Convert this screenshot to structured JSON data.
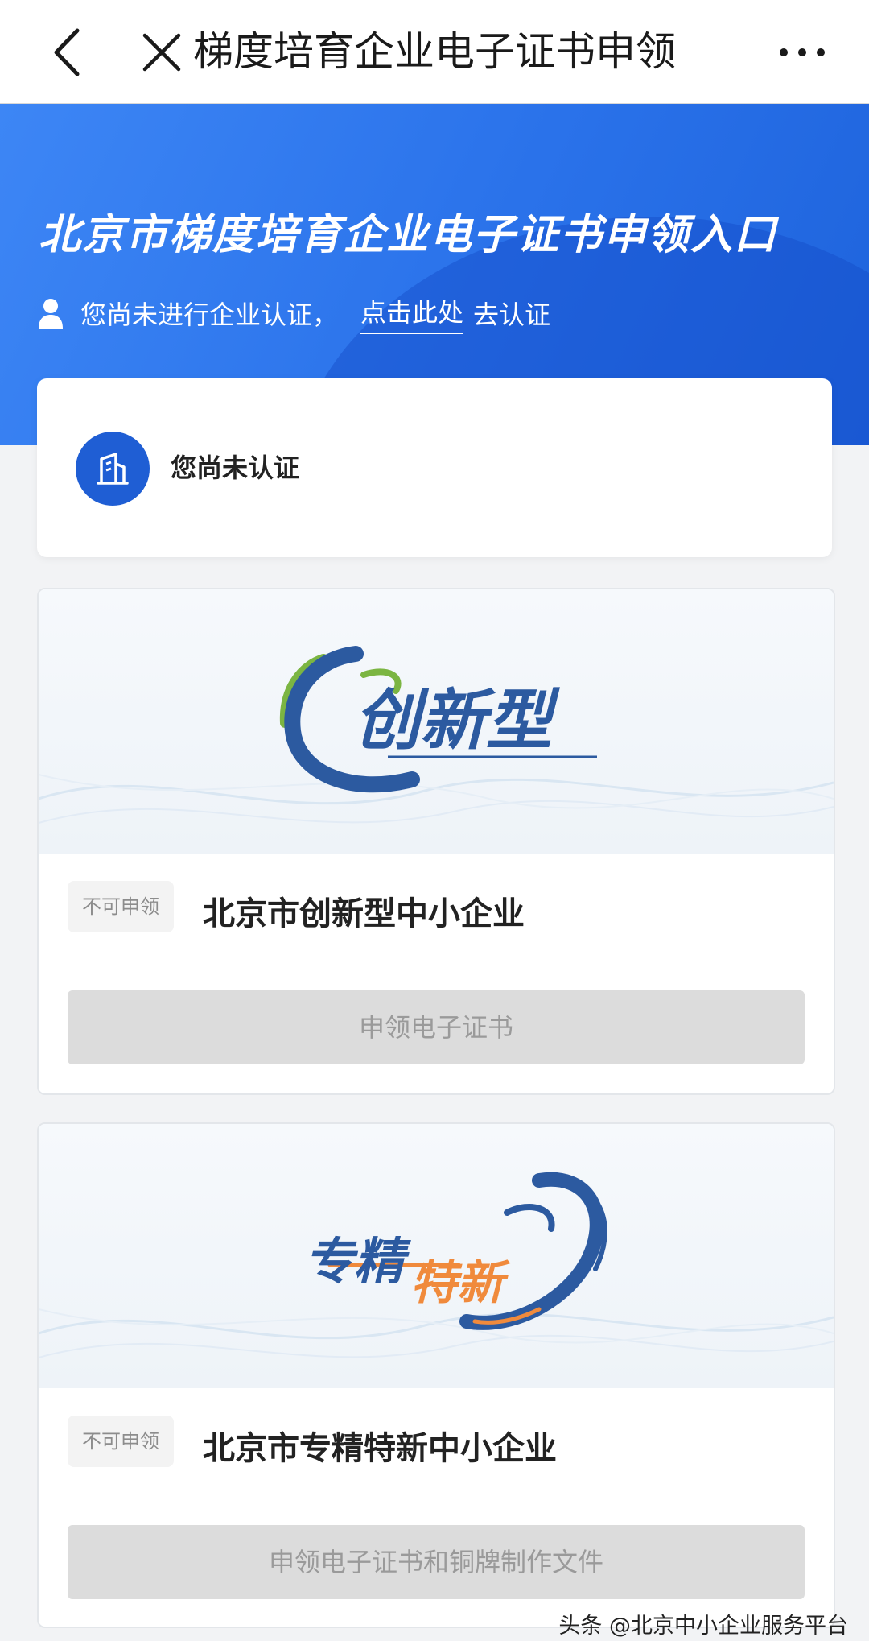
{
  "nav": {
    "title": "梯度培育企业电子证书申领"
  },
  "banner": {
    "title": "北京市梯度培育企业电子证书申领入口",
    "notice_prefix": "您尚未进行企业认证，",
    "notice_link": "点击此处",
    "notice_suffix": "去认证"
  },
  "status_card": {
    "text": "您尚未认证"
  },
  "cards": [
    {
      "logo_text": "创新型",
      "badge": "不可申领",
      "name": "北京市创新型中小企业",
      "button": "申领电子证书"
    },
    {
      "logo_text_1": "专精",
      "logo_text_2": "特新",
      "badge": "不可申领",
      "name": "北京市专精特新中小企业",
      "button": "申领电子证书和铜牌制作文件"
    }
  ],
  "watermark": "头条 @北京中小企业服务平台",
  "colors": {
    "primary_blue": "#2a72ea",
    "logo_blue": "#2c5aa0",
    "logo_orange": "#f08a3c",
    "logo_green": "#7bb542",
    "disabled_button": "#dcdcdc"
  },
  "icons": [
    "back-arrow-icon",
    "close-icon",
    "more-icon",
    "user-icon",
    "building-icon"
  ]
}
